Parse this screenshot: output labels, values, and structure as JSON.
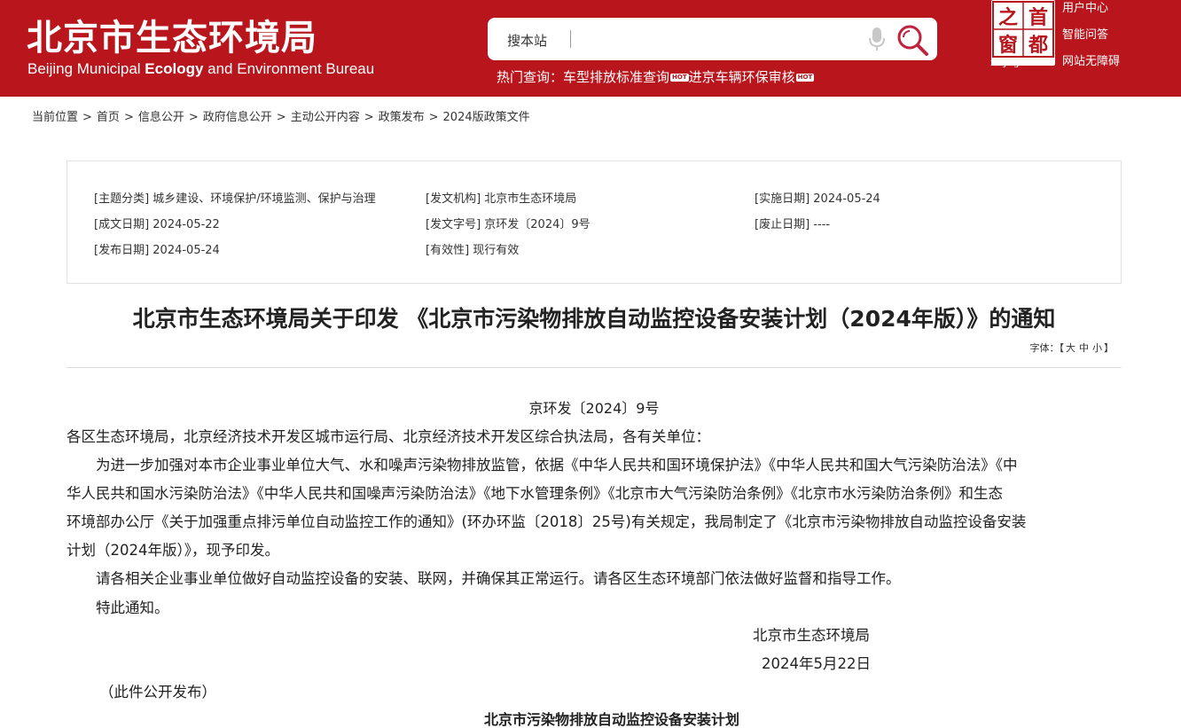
{
  "header": {
    "title": "北京市生态环境局",
    "subtitle_pre": "Beijing Municipal ",
    "subtitle_bold": "Ecology",
    "subtitle_post": " and Environment Bureau",
    "search_label": "搜本站",
    "search_value": "",
    "hot_label": "热门查询：",
    "hot_links": [
      "车型排放标准查询",
      "进京车辆环保审核"
    ],
    "hot_tag": "HOT",
    "logo_chars": [
      "之",
      "首",
      "窗",
      "都"
    ],
    "logo_caption": "Beijing-China",
    "top_links": [
      "用户中心",
      "智能问答",
      "网站无障碍"
    ],
    "brand_color": "#b8151d"
  },
  "breadcrumb": {
    "items": [
      "当前位置",
      "首页",
      "信息公开",
      "政府信息公开",
      "主动公开内容",
      "政策发布",
      "2024版政策文件"
    ],
    "separator": ">"
  },
  "meta": {
    "topic": "[主题分类] 城乡建设、环境保护/环境监测、保护与治理",
    "issuer": "[发文机构] 北京市生态环境局",
    "effective_date": "[实施日期] 2024-05-24",
    "created_date": "[成文日期] 2024-05-22",
    "doc_no": "[发文字号] 京环发〔2024〕9号",
    "abolish_date": "[废止日期] ----",
    "publish_date": "[发布日期] 2024-05-24",
    "validity": "[有效性] 现行有效"
  },
  "document": {
    "title": "北京市生态环境局关于印发 《北京市污染物排放自动监控设备安装计划（2024年版）》的通知",
    "font_label": "字体：【",
    "font_sizes": [
      "大",
      "中",
      "小"
    ],
    "font_end": "】",
    "number": "京环发〔2024〕9号",
    "lines": [
      "各区生态环境局，北京经济技术开发区城市运行局、北京经济技术开发区综合执法局，各有关单位：",
      "　　为进一步加强对本市企业事业单位大气、水和噪声污染物排放监管，依据《中华人民共和国环境保护法》《中华人民共和国大气污染防治法》《中",
      "华人民共和国水污染防治法》《中华人民共和国噪声污染防治法》《地下水管理条例》《北京市大气污染防治条例》《北京市水污染防治条例》和生态",
      "环境部办公厅《关于加强重点排污单位自动监控工作的通知》(环办环监〔2018〕25号)有关规定，我局制定了《北京市污染物排放自动监控设备安装",
      "计划（2024年版）》，现予印发。",
      "　　请各相关企业事业单位做好自动监控设备的安装、联网，并确保其正常运行。请各区生态环境部门依法做好监督和指导工作。",
      "　　特此通知。"
    ],
    "signer": "北京市生态环境局",
    "sign_date": "2024年5月22日",
    "disclosure": "（此件公开发布）",
    "appendix_title": "北京市污染物排放自动监控设备安装计划"
  }
}
